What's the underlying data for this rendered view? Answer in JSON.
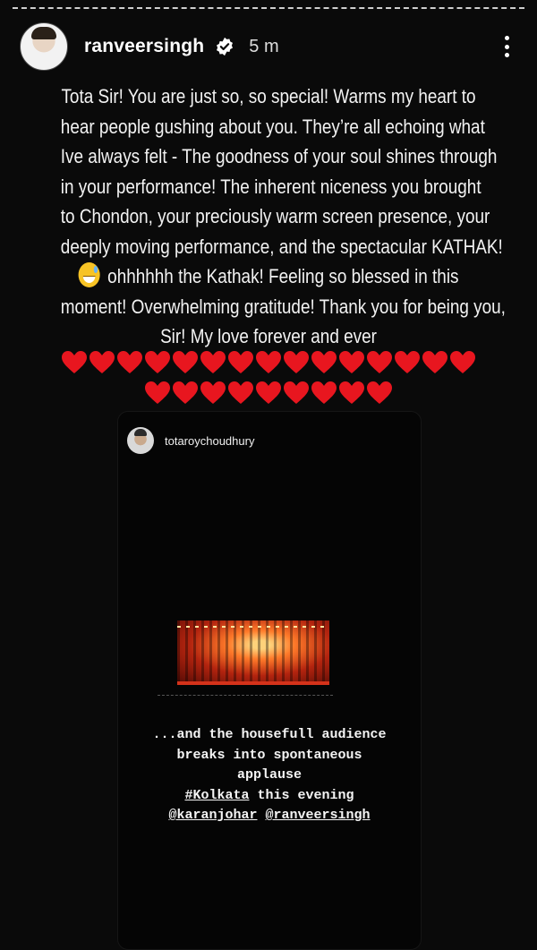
{
  "story": {
    "username": "ranveersingh",
    "time": "5 m",
    "caption_lines": [
      "Tota Sir! You are just so, so special! Warms my heart to",
      "hear people gushing about you. They’re all echoing what",
      "Ive always felt - The goodness of your soul shines through",
      "in your performance! The inherent niceness you brought",
      "to Chondon, your preciously warm screen presence, your",
      "deeply moving performance, and the spectacular KATHAK!",
      "ohhhhhh the Kathak! Feeling so blessed in this",
      "moment! Overwhelming gratitude! Thank you for being you,",
      "Sir! My love forever and ever"
    ],
    "emoji": "grinning-sweat-emoji",
    "hearts_row1_count": 15,
    "hearts_row2_count": 9,
    "heart_color": "#e8161f"
  },
  "shared_post": {
    "username": "totaroychoudhury",
    "line1": "...and the housefull audience",
    "line2": "breaks into spontaneous",
    "line3": "applause",
    "hashtag": "#Kolkata",
    "line4_rest": " this evening",
    "mention1": "@karanjohar",
    "mention2": "@ranveersingh"
  }
}
